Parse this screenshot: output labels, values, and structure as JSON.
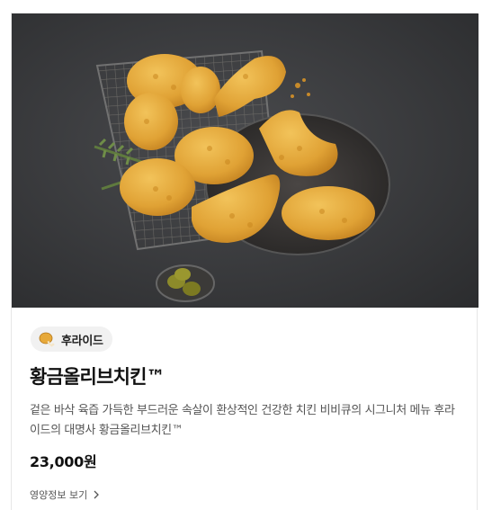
{
  "product": {
    "category_label": "후라이드",
    "category_icon": "chicken-drumstick-icon",
    "name": "황금올리브치킨™",
    "description": "겉은 바삭 육즙 가득한 부드러운 속살이 환상적인 건강한 치킨 비비큐의 시그니처 메뉴 후라이드의 대명사 황금올리브치킨™",
    "price": "23,000원",
    "nutrition_link": "영양정보 보기"
  },
  "colors": {
    "photo_background": "#3a3b3d",
    "chicken": "#e0a235",
    "chip_background": "#f1f1f1"
  }
}
